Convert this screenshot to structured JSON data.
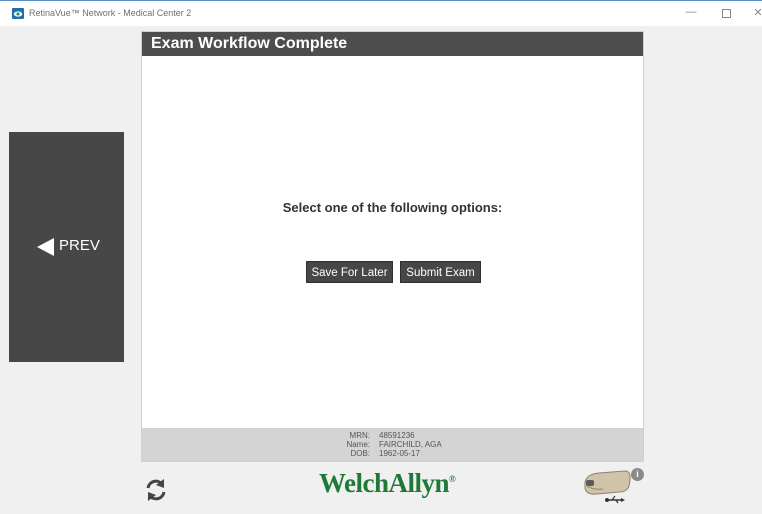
{
  "window": {
    "title": "RetinaVue™ Network - Medical Center 2",
    "minimize": "—",
    "close": "✕"
  },
  "nav": {
    "prev_label": "PREV"
  },
  "dialog": {
    "title": "Exam Workflow Complete",
    "prompt": "Select one of the following options:",
    "save_label": "Save For Later",
    "submit_label": "Submit Exam"
  },
  "patient": {
    "mrn_label": "MRN:",
    "mrn": "48591236",
    "name_label": "Name:",
    "name": "FAIRCHILD, AGA",
    "dob_label": "DOB:",
    "dob": "1962-05-17"
  },
  "footer": {
    "logo_text": "WelchAllyn",
    "logo_mark": "®",
    "info_glyph": "i"
  },
  "colors": {
    "panel_dark": "#474747",
    "header_dark": "#4d4d4d",
    "brand_green": "#1f7a3a",
    "patient_bar": "#d4d4d4"
  },
  "icons": [
    "app-icon",
    "prev-arrow-icon",
    "refresh-icon",
    "usb-device-icon",
    "info-icon"
  ]
}
